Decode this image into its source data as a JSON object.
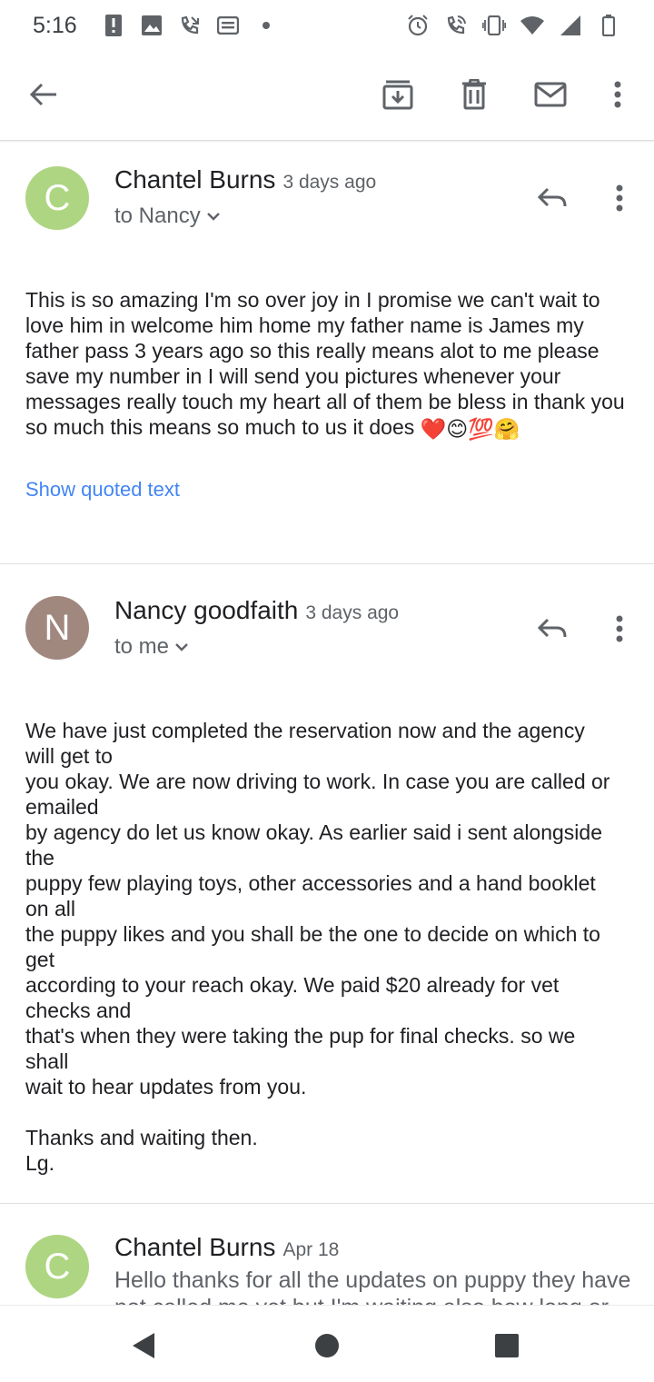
{
  "status_bar": {
    "time": "5:16",
    "left_icons": [
      "alert-icon",
      "image-icon",
      "missed-call-icon",
      "message-icon",
      "dot-icon"
    ],
    "right_icons": [
      "alarm-icon",
      "wifi-call-icon",
      "vibrate-icon",
      "wifi-icon",
      "signal-icon",
      "battery-icon"
    ]
  },
  "toolbar": {
    "icons": [
      "back-arrow-icon",
      "archive-icon",
      "delete-icon",
      "mark-unread-icon",
      "more-vert-icon"
    ]
  },
  "emails": [
    {
      "avatar_letter": "C",
      "avatar_color": "#aed581",
      "sender": "Chantel Burns",
      "date": "3 days ago",
      "recipient": "to Nancy",
      "body": "This is so amazing I'm so over joy in I promise we can't wait to love him in welcome him home my father name is James my father pass 3 years ago so this really means alot to me please save my number in I will send you pictures whenever your messages really touch my heart all of them be bless in thank you so much this means so much to us it does",
      "emojis": [
        "❤️",
        "😊",
        "💯",
        "🤗"
      ],
      "show_quoted": "Show quoted text"
    },
    {
      "avatar_letter": "N",
      "avatar_color": "#a1887f",
      "sender": "Nancy goodfaith",
      "date": "3 days ago",
      "recipient": "to me",
      "body": "We have just completed the reservation now and the agency\nwill get to\nyou okay. We are now driving to work. In case you are called or\nemailed\nby agency do let us know okay. As earlier said i sent alongside\nthe\npuppy few playing toys, other accessories and a hand booklet\non all\nthe puppy likes and you shall be the one to decide on which to\nget\naccording to your reach okay. We paid $20 already for vet\nchecks and\nthat's when they were taking the pup for final checks. so we\nshall\nwait to hear updates from you.\n\nThanks and waiting then.\nLg."
    },
    {
      "avatar_letter": "C",
      "avatar_color": "#aed581",
      "sender": "Chantel Burns",
      "date": "Apr 18",
      "snippet": "Hello thanks for all the updates on puppy they have not called me yet but I'm waiting also how long or"
    }
  ],
  "navbar": {
    "icons": [
      "nav-back-icon",
      "nav-home-icon",
      "nav-recents-icon"
    ]
  }
}
